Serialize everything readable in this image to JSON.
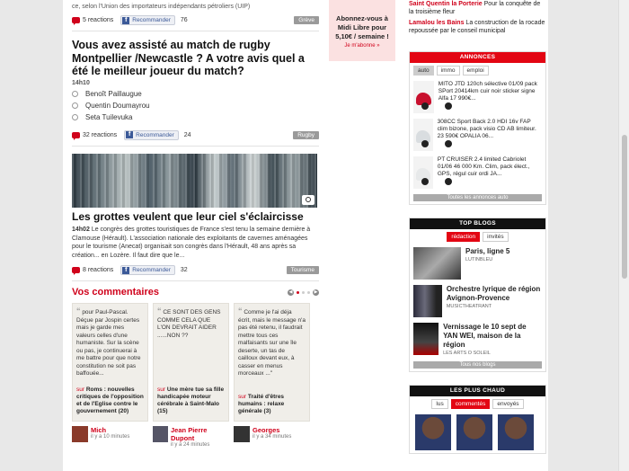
{
  "top_snippet": "ce, selon l'Union des importateurs indépendants pétroliers (UIP)",
  "articles": [
    {
      "reactions": "5 reactions",
      "fb": "Recommander",
      "count": "76",
      "tag": "Grève"
    },
    {
      "title": "Vous avez assisté au match de rugby Montpellier /Newcastle ? A votre avis quel a été le meilleur joueur du match?",
      "time": "14h10",
      "options": [
        "Benoît Paillaugue",
        "Quentin Doumayrou",
        "Seta Tuilevuka"
      ],
      "reactions": "32 reactions",
      "fb": "Recommander",
      "count": "24",
      "tag": "Rugby"
    },
    {
      "title": "Les grottes veulent que leur ciel s'éclaircisse",
      "time": "14h02",
      "desc": "Le congrès des grottes touristiques de France s'est tenu la semaine dernière à Clamouse (Hérault). L'association nationale des exploitants de cavernes aménagées pour le tourisme (Anecat) organisait son congrès dans l'Hérault, 48 ans après sa création... en Lozère. Il faut dire que le...",
      "reactions": "8 reactions",
      "fb": "Recommander",
      "count": "32",
      "tag": "Tourisme"
    }
  ],
  "comments": {
    "title": "Vos commentaires",
    "items": [
      {
        "quote": "pour Paul-Pascal. Déçue par Jospin certes mais je garde mes valeurs celles d'une humaniste. Sur la scène ou pas, je continuerai à me battre pour que notre constitution ne soit pas baffouée...",
        "sur": "sur",
        "link": "Roms : nouvelles critiques de l'opposition et de l'Eglise contre le gouvernement (20)",
        "author": "Mich",
        "ago": "il y a 10 minutes"
      },
      {
        "quote": "CE SONT DES GENS COMME CELA QUE L'ON DEVRAIT AIDER ......NON ??",
        "sur": "sur",
        "link": "Une mère tue sa fille handicapée moteur cérébrale à Saint-Malo (15)",
        "author": "Jean Pierre Dupont",
        "ago": "il y a 24 minutes"
      },
      {
        "quote": "Comme je l'ai déja écrit, mais le message n'a pas été retenu, il faudrait mettre tous ces malfaisants sur une île deserte, un tas de cailloux devant eux, à casser en menus morceaux ...\"",
        "sur": "sur",
        "link": "Traité d'êtres humains : relaxe générale (3)",
        "author": "Georges",
        "ago": "il y a 34 minutes"
      }
    ]
  },
  "promo": {
    "text": "Abonnez-vous à Midi Libre pour 5,10€ / semaine !",
    "link": "Je m'abonne »"
  },
  "side_news": [
    {
      "place": "Saint Quentin la Porterie",
      "text": "Pour la conquête de la troisième fleur"
    },
    {
      "place": "Lamalou les Bains",
      "text": "La construction de la rocade repoussée par le conseil municipal"
    }
  ],
  "annonces": {
    "header": "ANNONCES",
    "tabs": [
      "auto",
      "immo",
      "emploi"
    ],
    "items": [
      "MITO JTD 120ch sélective 01/09 pack SPort 20414km cuir noir sticker signe Alfa 17 990€...",
      "308CC Sport Back 2.0 HDI 16v FAP clim bizone, pack visio CD AB limiteur. 23 590€ OPALIA 06...",
      "PT CRUISER 2.4 limited Cabriolet 01/06 46 000 Km. Clim, pack élect., GPS, régul cuir ordi JA..."
    ],
    "more": "Toutes les annonces auto"
  },
  "blogs": {
    "header": "TOP BLOGS",
    "tabs": [
      "rédaction",
      "invités"
    ],
    "items": [
      {
        "title": "Paris, ligne 5",
        "source": "LUTINBLEU"
      },
      {
        "title": "Orchestre lyrique de région Avignon-Provence",
        "source": "MUSICTHEATRANT"
      },
      {
        "title": "Vernissage le 10 sept de YAN WEI, maison de la région",
        "source": "LES ARTS O SOLEIL"
      }
    ],
    "more": "Tous nos blogs"
  },
  "hot": {
    "header": "LES PLUS CHAUD",
    "tabs": [
      "lus",
      "commentés",
      "envoyés"
    ]
  }
}
